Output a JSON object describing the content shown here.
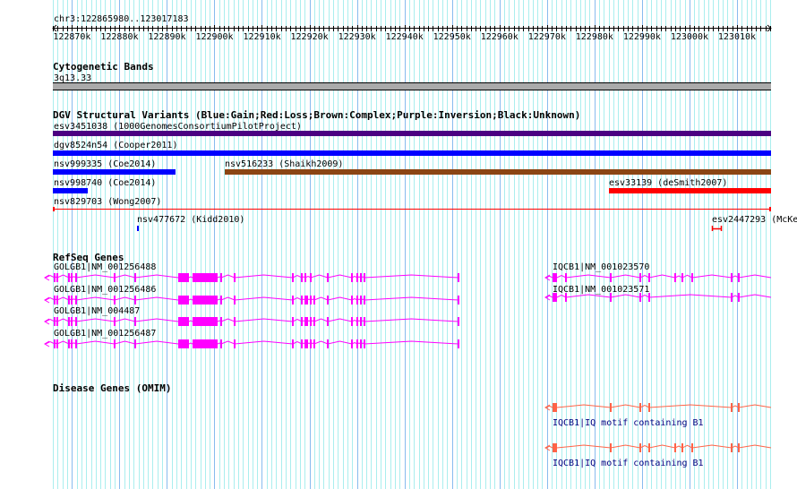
{
  "ruler": {
    "region": "chr3:122865980..123017183",
    "start": 122865980,
    "end": 123017183,
    "ticks": [
      "122870k",
      "122880k",
      "122890k",
      "122900k",
      "122910k",
      "122920k",
      "122930k",
      "122940k",
      "122950k",
      "122960k",
      "122970k",
      "122980k",
      "122990k",
      "123000k",
      "123010k"
    ]
  },
  "cytoband": {
    "title": "Cytogenetic Bands",
    "band": "3q13.33",
    "color": "#aaaaaa"
  },
  "dgv": {
    "title": "DGV Structural Variants (Blue:Gain;Red:Loss;Brown:Complex;Purple:Inversion;Black:Unknown)",
    "features": [
      {
        "label": "esv3451038 (1000GenomesConsortiumPilotProject)",
        "type": "Inversion",
        "color": "#4b0082"
      },
      {
        "label": "dgv8524n54 (Cooper2011)",
        "type": "Gain",
        "color": "#0000ff"
      },
      {
        "label": "nsv999335 (Coe2014)",
        "type": "Gain",
        "color": "#0000ff"
      },
      {
        "label": "nsv516233 (Shaikh2009)",
        "type": "Complex",
        "color": "#8b4513"
      },
      {
        "label": "nsv998740 (Coe2014)",
        "type": "Gain",
        "color": "#0000ff"
      },
      {
        "label": "esv33139 (deSmith2007)",
        "type": "Loss",
        "color": "#ff0000"
      },
      {
        "label": "nsv829703 (Wong2007)",
        "type": "Loss",
        "color": "#ff0000"
      },
      {
        "label": "nsv477672 (Kidd2010)",
        "type": "Gain",
        "color": "#0000ff"
      },
      {
        "label": "esv2447293 (McKe",
        "type": "Loss",
        "color": "#ff0000"
      }
    ]
  },
  "refseq": {
    "title": "RefSeq Genes",
    "color": "#ff00ff",
    "genes": [
      {
        "label": "GOLGB1|NM_001256488"
      },
      {
        "label": "GOLGB1|NM_001256486"
      },
      {
        "label": "GOLGB1|NM_004487"
      },
      {
        "label": "GOLGB1|NM_001256487"
      },
      {
        "label": "IQCB1|NM_001023570"
      },
      {
        "label": "IQCB1|NM_001023571"
      }
    ]
  },
  "omim": {
    "title": "Disease Genes (OMIM)",
    "color": "#ff6347",
    "label_color": "#000080",
    "genes": [
      {
        "label": "IQCB1|IQ motif containing B1"
      },
      {
        "label": "IQCB1|IQ motif containing B1"
      }
    ]
  },
  "grid": {
    "major_color": "#88bbee",
    "minor_color": "#aaeeee"
  }
}
